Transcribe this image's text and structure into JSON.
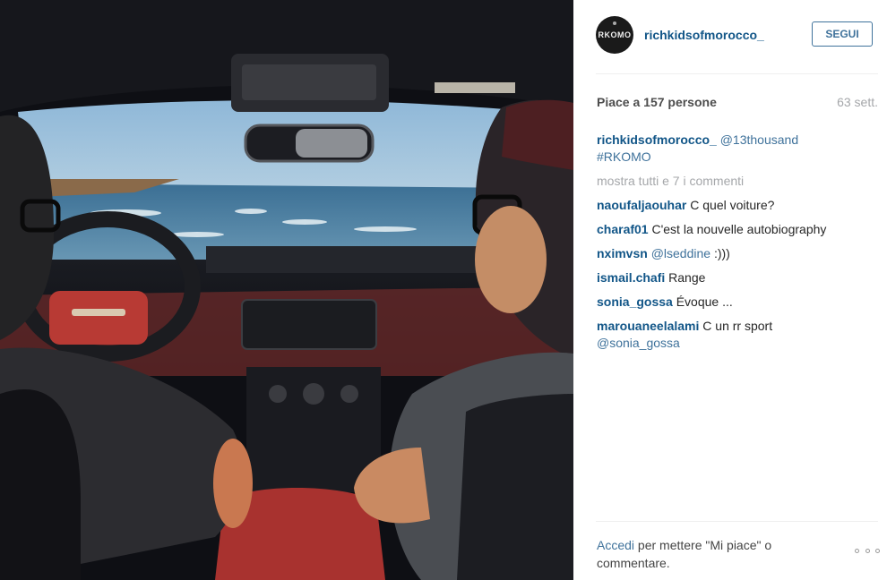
{
  "post": {
    "avatar_text": "RKOMO",
    "username": "richkidsofmorocco_",
    "follow_label": "SEGUI",
    "likes": "Piace a 157 persone",
    "time": "63 sett."
  },
  "caption": {
    "user": "richkidsofmorocco_",
    "mention": "@13thousand",
    "tag": "#RKOMO"
  },
  "show_all": "mostra tutti e 7 i commenti",
  "comments": [
    {
      "user": "naoufaljaouhar",
      "text": "C quel voiture?"
    },
    {
      "user": "charaf01",
      "text": "C'est la nouvelle autobiography"
    },
    {
      "user": "nximvsn",
      "mention": "@lseddine",
      "text": " :)))"
    },
    {
      "user": "ismail.chafi",
      "text": "Range"
    },
    {
      "user": "sonia_gossa",
      "text": "Évoque ..."
    },
    {
      "user": "marouaneelalami",
      "text": "C un rr sport",
      "mention": "@sonia_gossa"
    }
  ],
  "footer": {
    "login_link": "Accedi",
    "rest": "per mettere \"Mi piace\" o commentare."
  },
  "icons": {
    "more": "more-options-icon",
    "photo": "car-interior-photo"
  }
}
